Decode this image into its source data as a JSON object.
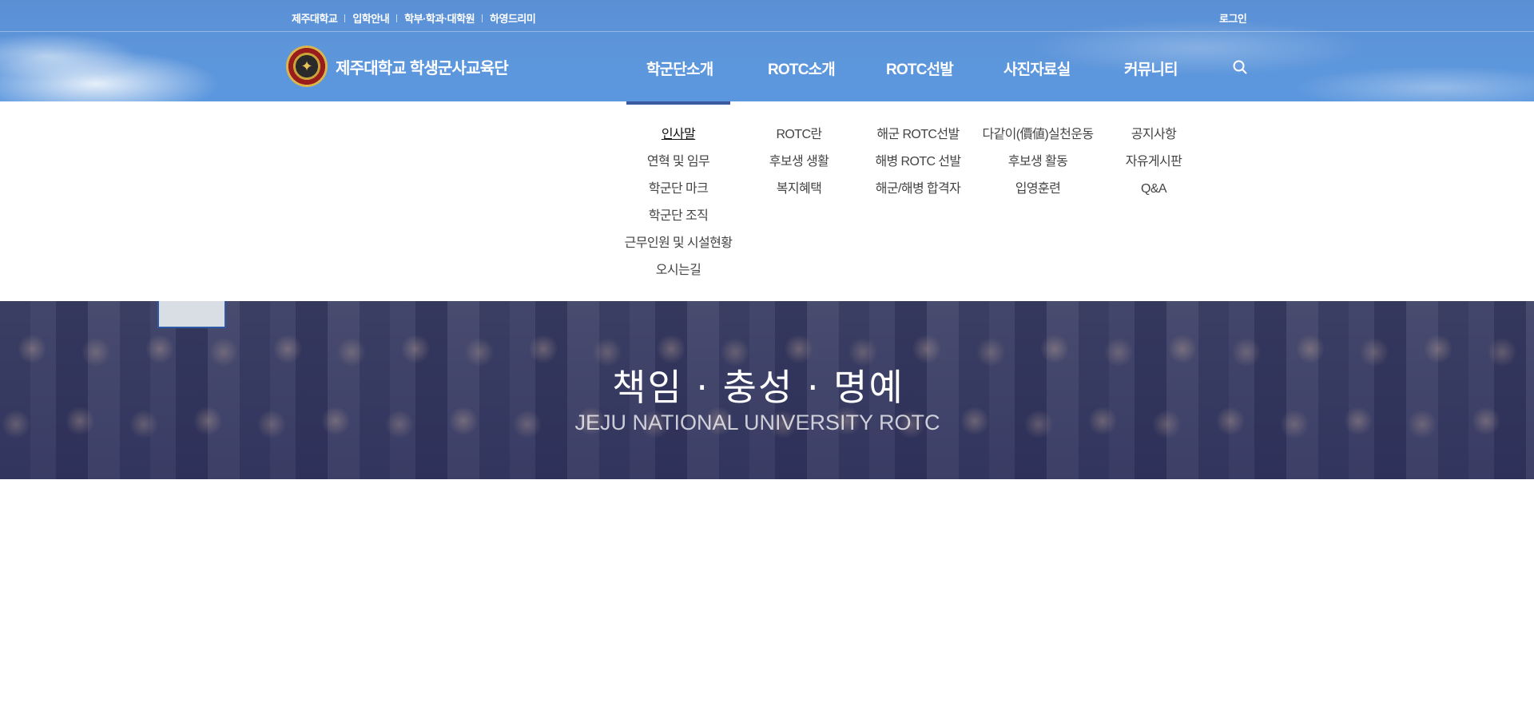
{
  "util_nav": {
    "links": [
      "제주대학교",
      "입학안내",
      "학부·학과·대학원",
      "하영드리미"
    ],
    "login": "로그인"
  },
  "logo": {
    "text": "제주대학교 학생군사교육단"
  },
  "gnb": {
    "items": [
      "학군단소개",
      "ROTC소개",
      "ROTC선발",
      "사진자료실",
      "커뮤니티"
    ],
    "search_icon": "search-icon"
  },
  "dropdown": {
    "columns": [
      [
        "인사말",
        "연혁 및 임무",
        "학군단 마크",
        "학군단 조직",
        "근무인원 및 시설현황",
        "오시는길"
      ],
      [
        "ROTC란",
        "후보생 생활",
        "복지혜택"
      ],
      [
        "해군 ROTC선발",
        "해병 ROTC 선발",
        "해군/해병 합격자"
      ],
      [
        "다같이(價値)실천운동",
        "후보생 활동",
        "입영훈련"
      ],
      [
        "공지사항",
        "자유게시판",
        "Q&A"
      ]
    ],
    "active_color": "#3a5aa0"
  },
  "hero": {
    "title": "책임 · 충성 · 명예",
    "subtitle": "JEJU NATIONAL UNIVERSITY ROTC"
  }
}
